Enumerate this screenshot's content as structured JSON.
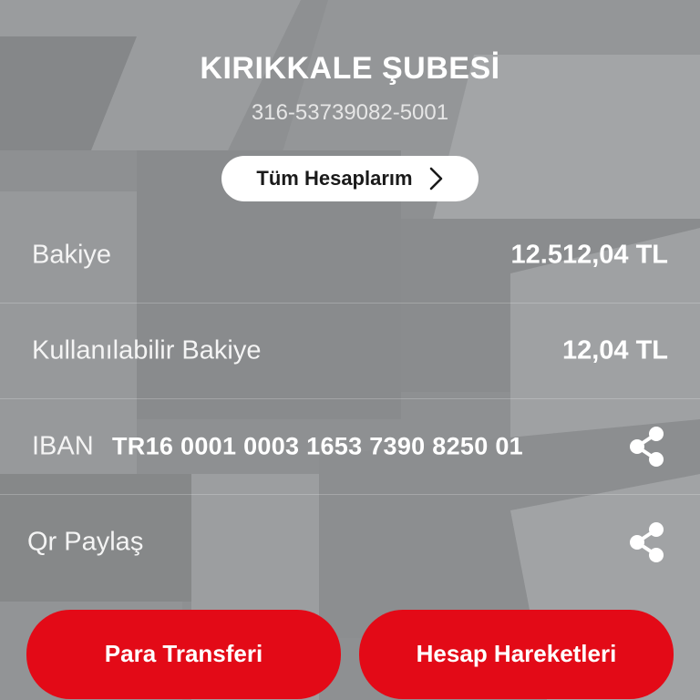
{
  "account": {
    "branch_name": "KIRIKKALE ŞUBESİ",
    "account_number": "316-53739082-5001"
  },
  "all_accounts_button": {
    "label": "Tüm Hesaplarım",
    "icon": "chevron-right-icon"
  },
  "details": {
    "balance_label": "Bakiye",
    "balance_value": "12.512,04 TL",
    "available_balance_label": "Kullanılabilir Bakiye",
    "available_balance_value": "12,04 TL",
    "iban_label": "IBAN",
    "iban_value": "TR16 0001 0003 1653 7390 8250 01",
    "iban_share_icon": "share-icon",
    "qr_share_label": "Qr Paylaş",
    "qr_share_icon": "share-icon"
  },
  "actions": {
    "transfer_label": "Para Transferi",
    "history_label": "Hesap Hareketleri"
  },
  "colors": {
    "background": "#8f9193",
    "accent_red": "#e30a17",
    "pill_white": "#ffffff"
  }
}
